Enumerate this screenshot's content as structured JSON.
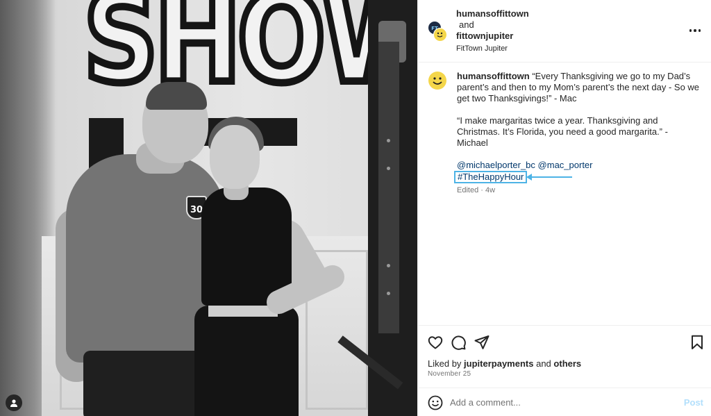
{
  "post": {
    "header": {
      "user1": "humansoffittown",
      "conjunction": "and",
      "user2": "fittownjupiter",
      "location": "FitTown Jupiter",
      "avatar_icon": "collab-avatar-icon",
      "more_icon": "more-options-icon"
    },
    "caption": {
      "author": "humansoffittown",
      "line1": "“Every Thanksgiving we go to my Dad’s parent’s and then to my Mom’s parent’s the next day - So we get two Thanksgivings!” - Mac",
      "line2": "“I make margaritas twice a year. Thanksgiving and Christmas. It’s Florida, you need a good margarita.” - Michael",
      "mention1": "@michaelporter_bc",
      "mention2": "@mac_porter",
      "hashtag": "#TheHappyHour",
      "meta": "Edited · 4w",
      "highlight_color": "#4db3e6"
    },
    "photo": {
      "sign_text": "SHOW",
      "badge_text": "30"
    },
    "actions": {
      "like_icon": "heart-icon",
      "comment_icon": "comment-icon",
      "share_icon": "share-icon",
      "save_icon": "bookmark-icon"
    },
    "likes": {
      "prefix": "Liked by",
      "user": "jupiterpayments",
      "connector": "and",
      "others": "others"
    },
    "date": "November 25",
    "comment": {
      "placeholder": "Add a comment...",
      "post_label": "Post",
      "emoji_icon": "emoji-icon"
    }
  }
}
